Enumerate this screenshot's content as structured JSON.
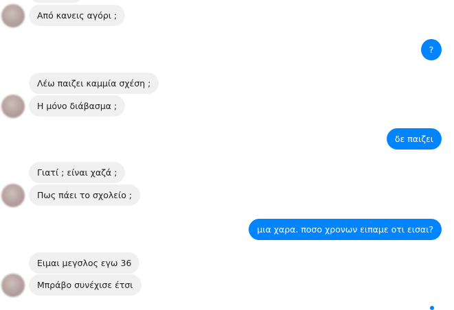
{
  "conversation": {
    "messages": [
      {
        "side": "in",
        "text": "Από κανεις αγόρι ;"
      },
      {
        "side": "out",
        "text": "?"
      },
      {
        "side": "in",
        "text": "Λέω παιζει καμμία σχέση ;"
      },
      {
        "side": "in",
        "text": "Η μόνο διάβασμα ;"
      },
      {
        "side": "out",
        "text": "δε παιζει"
      },
      {
        "side": "in",
        "text": "Γιατί ; είναι χαζά ;"
      },
      {
        "side": "in",
        "text": "Πως πάει το σχολείο ;"
      },
      {
        "side": "out",
        "text": "μια χαρα. ποσο χρονων ειπαμε οτι εισαι?"
      },
      {
        "side": "in",
        "text": "Ειμαι μεγσλος εγω 36"
      },
      {
        "side": "in",
        "text": "Μπράβο συνέχισε έτσι"
      }
    ]
  },
  "colors": {
    "incoming_bubble": "#f1f0f0",
    "outgoing_bubble": "#0084ff",
    "incoming_text": "#1c1e21",
    "outgoing_text": "#ffffff"
  }
}
